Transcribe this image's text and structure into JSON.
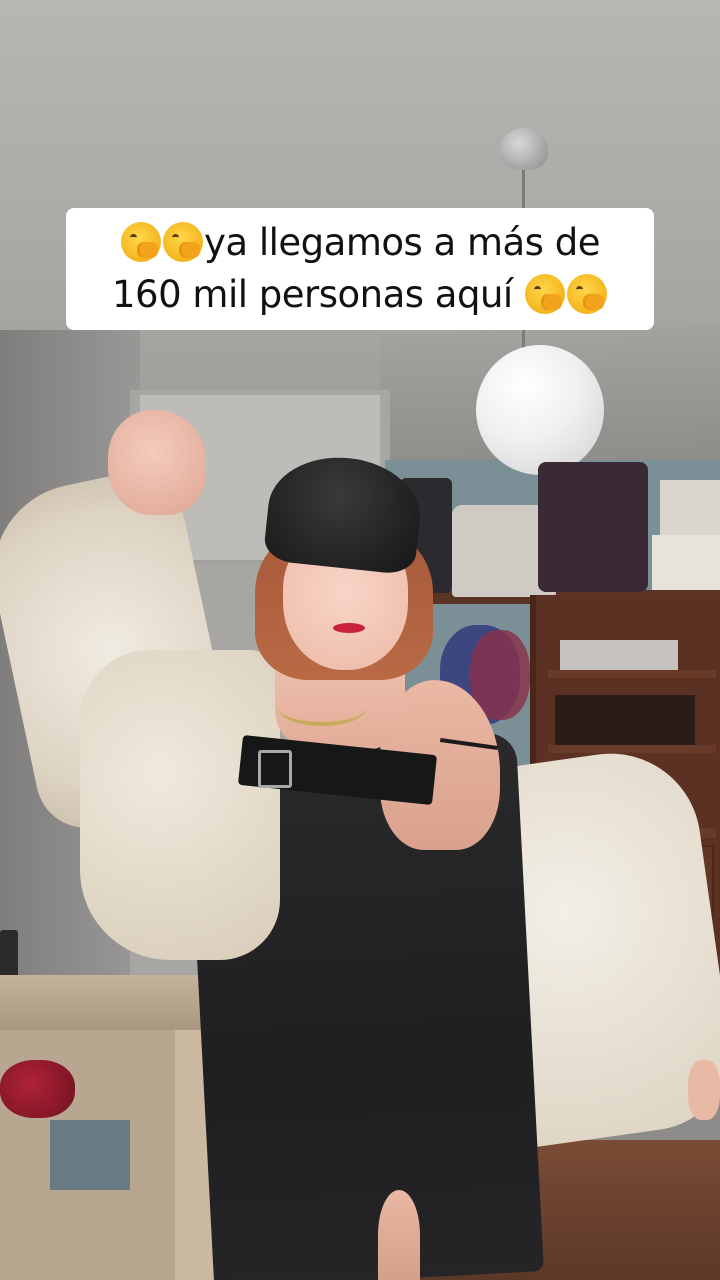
{
  "caption": {
    "line1_text": "ya llegamos a más de",
    "line2_text": "160 mil personas aquí",
    "emoji_name": "face-with-hand-over-mouth"
  },
  "colors": {
    "caption_background": "#ffffff",
    "caption_text": "#111111",
    "emoji_yellow": "#f4b21a"
  }
}
